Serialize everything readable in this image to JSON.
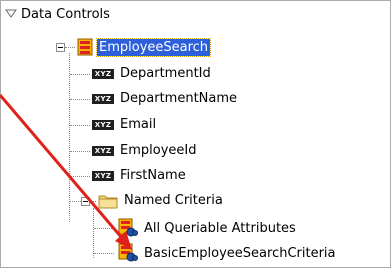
{
  "panel": {
    "title": "Data Controls"
  },
  "tree": {
    "root": {
      "label": "EmployeeSearch",
      "selected": true
    },
    "attributes": [
      {
        "label": "DepartmentId",
        "type_badge": "XYZ"
      },
      {
        "label": "DepartmentName",
        "type_badge": "XYZ"
      },
      {
        "label": "Email",
        "type_badge": "XYZ"
      },
      {
        "label": "EmployeeId",
        "type_badge": "XYZ"
      },
      {
        "label": "FirstName",
        "type_badge": "XYZ"
      }
    ],
    "folder": {
      "label": "Named Criteria"
    },
    "criteria": [
      {
        "label": "All Queriable Attributes"
      },
      {
        "label": "BasicEmployeeSearchCriteria"
      }
    ]
  },
  "annotation": {
    "arrow_color": "#e0201a"
  },
  "colors": {
    "selection": "#2c5fd9",
    "badge": "#202020"
  }
}
